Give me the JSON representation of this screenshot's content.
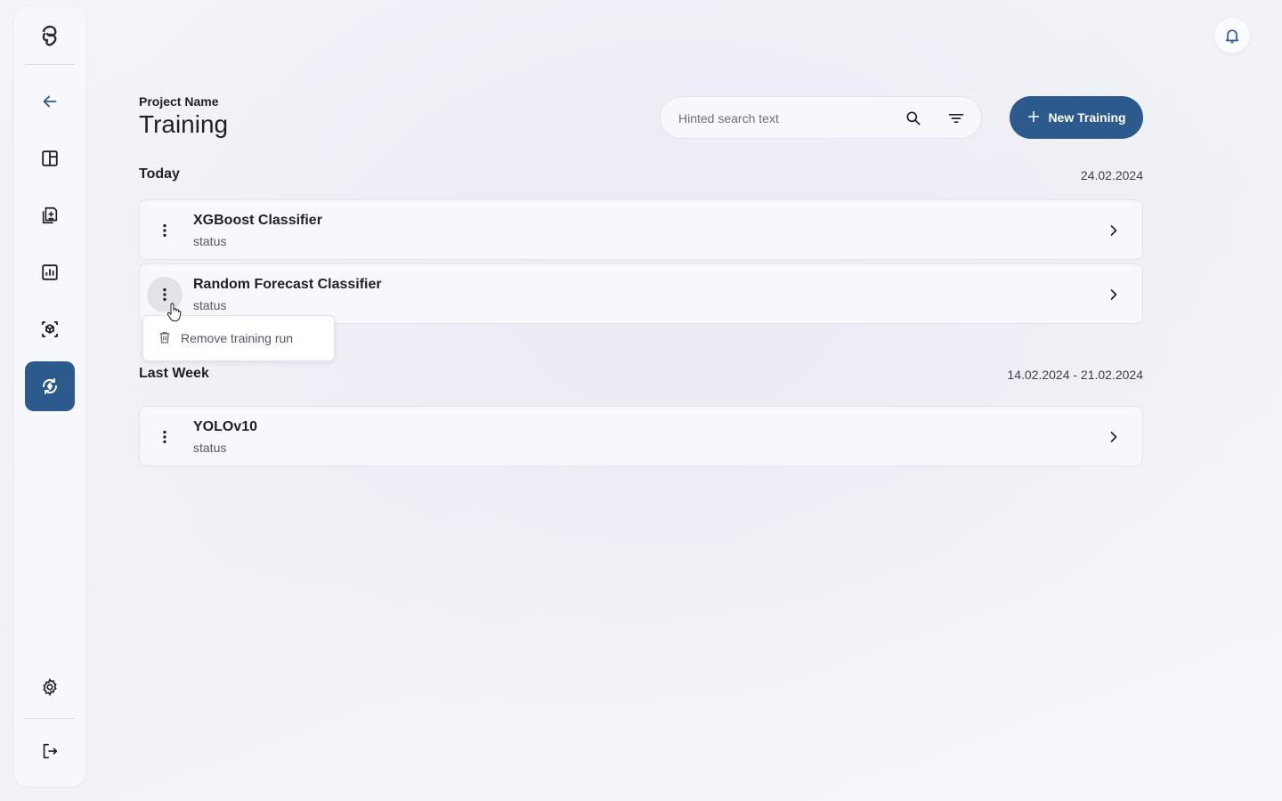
{
  "sidebar": {
    "logo": "logo-icon",
    "items": [
      {
        "icon": "arrow-left-icon",
        "name": "back"
      },
      {
        "icon": "dashboard-icon",
        "name": "dashboard"
      },
      {
        "icon": "document-add-icon",
        "name": "documents"
      },
      {
        "icon": "analytics-icon",
        "name": "analytics"
      },
      {
        "icon": "model-cube-icon",
        "name": "models"
      },
      {
        "icon": "training-icon",
        "name": "training",
        "active": true
      }
    ],
    "bottom": [
      {
        "icon": "gear-icon",
        "name": "settings"
      },
      {
        "icon": "logout-icon",
        "name": "logout"
      }
    ]
  },
  "header": {
    "eyebrow": "Project Name",
    "title": "Training",
    "search_placeholder": "Hinted search text",
    "new_button_label": "New Training"
  },
  "sections": [
    {
      "label": "Today",
      "date": "24.02.2024",
      "items": [
        {
          "name": "XGBoost Classifier",
          "status": "status"
        },
        {
          "name": "Random Forecast Classifier",
          "status": "status"
        }
      ]
    },
    {
      "label": "Last Week",
      "date": "14.02.2024 - 21.02.2024",
      "items": [
        {
          "name": "YOLOv10",
          "status": "status"
        }
      ]
    }
  ],
  "context_menu": {
    "item_label": "Remove training run",
    "icon": "trash-icon"
  },
  "colors": {
    "accent": "#2c5a8c",
    "background": "#f2f2f8",
    "card": "#f7f8fc"
  }
}
